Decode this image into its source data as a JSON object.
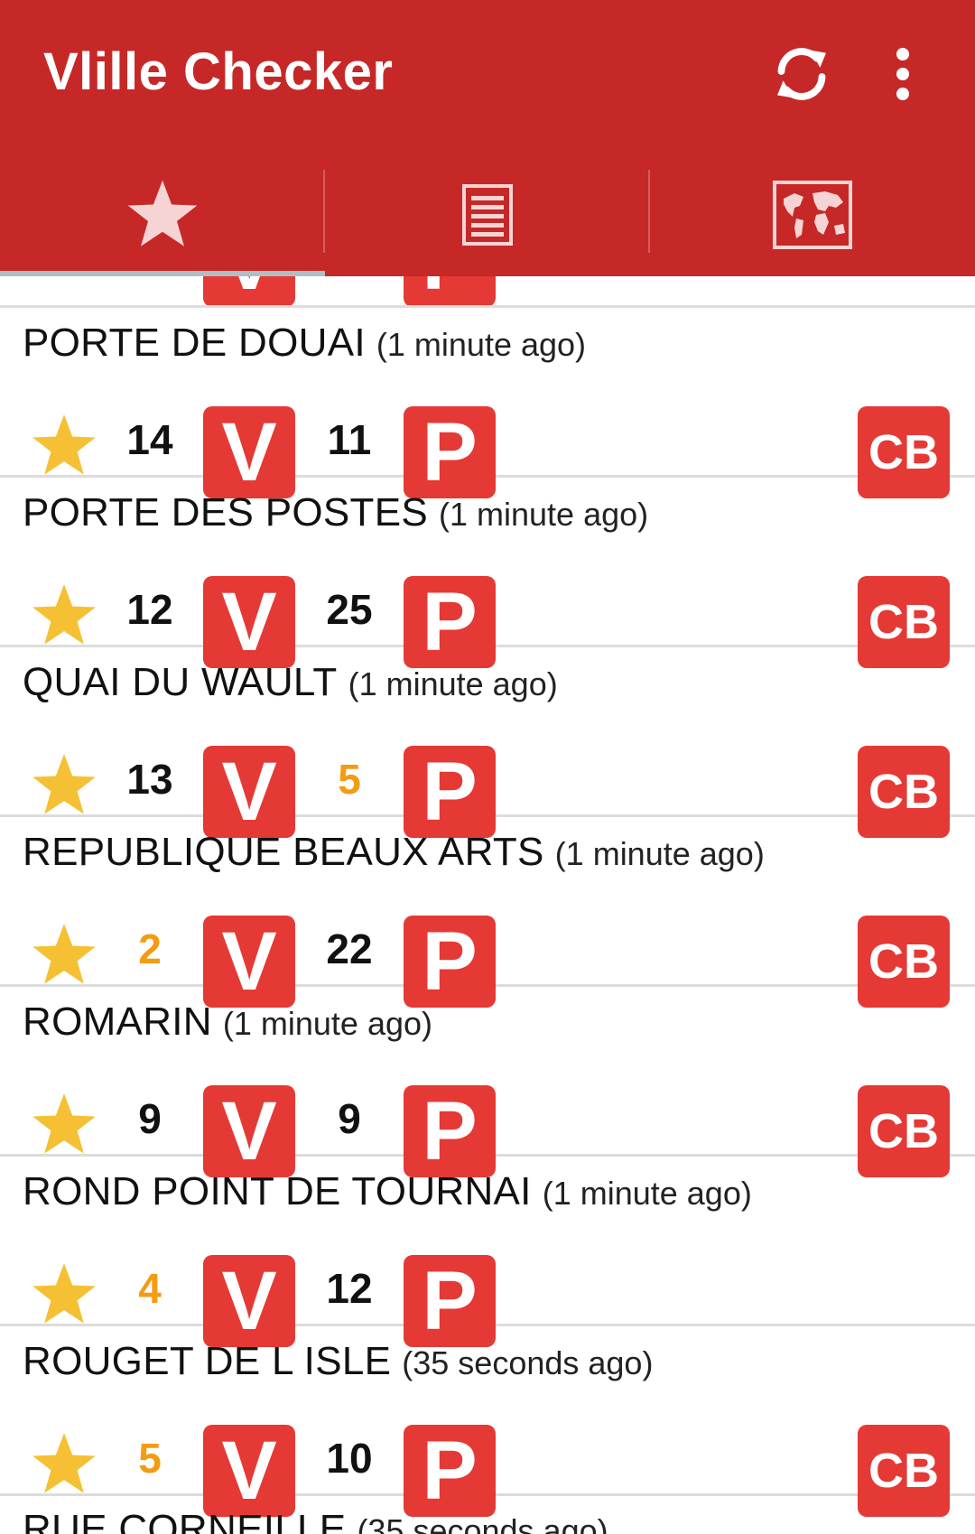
{
  "app": {
    "title": "Vlille Checker",
    "accent_color": "#c62828",
    "badge_color": "#e53935",
    "star_color": "#f5c033",
    "low_count_color": "#f39c12"
  },
  "toolbar": {
    "refresh_icon": "refresh-icon",
    "menu_icon": "more-vert-icon"
  },
  "tabs": [
    {
      "icon": "star-icon",
      "selected": true
    },
    {
      "icon": "list-icon",
      "selected": false
    },
    {
      "icon": "world-map-icon",
      "selected": false
    }
  ],
  "badges": {
    "bikes": "V",
    "places": "P",
    "card": "CB"
  },
  "stations": [
    {
      "name": "PORTE DE DOUAI",
      "updated": "(1 minute ago)",
      "bikes": "14",
      "places": "11",
      "bikes_low": false,
      "places_low": false,
      "card": true
    },
    {
      "name": "PORTE DES POSTES",
      "updated": "(1 minute ago)",
      "bikes": "12",
      "places": "25",
      "bikes_low": false,
      "places_low": false,
      "card": true
    },
    {
      "name": "QUAI DU WAULT",
      "updated": "(1 minute ago)",
      "bikes": "13",
      "places": "5",
      "bikes_low": false,
      "places_low": true,
      "card": true
    },
    {
      "name": "REPUBLIQUE BEAUX ARTS",
      "updated": "(1 minute ago)",
      "bikes": "2",
      "places": "22",
      "bikes_low": true,
      "places_low": false,
      "card": true
    },
    {
      "name": "ROMARIN",
      "updated": "(1 minute ago)",
      "bikes": "9",
      "places": "9",
      "bikes_low": false,
      "places_low": false,
      "card": true
    },
    {
      "name": "ROND POINT DE TOURNAI",
      "updated": "(1 minute ago)",
      "bikes": "4",
      "places": "12",
      "bikes_low": true,
      "places_low": false,
      "card": false
    },
    {
      "name": "ROUGET DE L ISLE",
      "updated": "(35 seconds ago)",
      "bikes": "5",
      "places": "10",
      "bikes_low": true,
      "places_low": false,
      "card": true
    }
  ],
  "partial_station": {
    "name": "RUE CORNEILLE",
    "updated": "(35 seconds ago)"
  }
}
